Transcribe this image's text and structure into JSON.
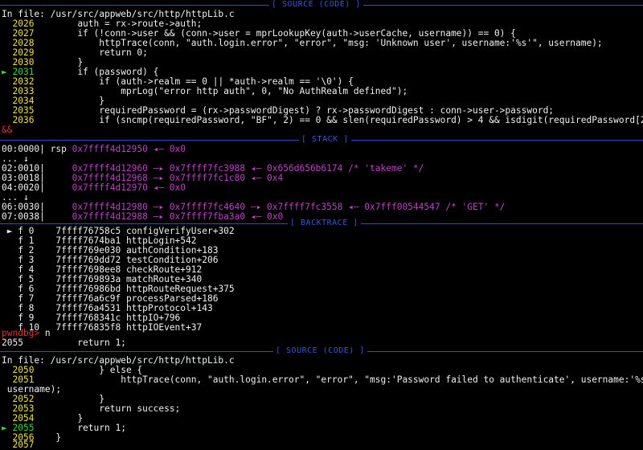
{
  "pane_titles": {
    "source_top": "[ SOURCE (CODE) ]",
    "stack": "[ STACK ]",
    "backtrace": "[ BACKTRACE ]",
    "source_bottom": "[ SOURCE (CODE) ]"
  },
  "source_top": {
    "file_label": "In file: /usr/src/appweb/src/http/httpLib.c",
    "lines": [
      {
        "no": "2026",
        "code": "        auth = rx->route->auth;",
        "current": false
      },
      {
        "no": "2027",
        "code": "        if (!conn->user && (conn->user = mprLookupKey(auth->userCache, username)) == 0) {",
        "current": false
      },
      {
        "no": "2028",
        "code": "            httpTrace(conn, \"auth.login.error\", \"error\", \"msg: 'Unknown user', username:'%s'\", username);",
        "current": false
      },
      {
        "no": "2029",
        "code": "            return 0;",
        "current": false
      },
      {
        "no": "2030",
        "code": "        }",
        "current": false
      },
      {
        "no": "2031",
        "code": "        if (password) {",
        "current": true
      },
      {
        "no": "2032",
        "code": "            if (auth->realm == 0 || *auth->realm == '\\0') {",
        "current": false
      },
      {
        "no": "2033",
        "code": "                mprLog(\"error http auth\", 0, \"No AuthRealm defined\");",
        "current": false
      },
      {
        "no": "2034",
        "code": "            }",
        "current": false
      },
      {
        "no": "2035",
        "code": "            requiredPassword = (rx->passwordDigest) ? rx->passwordDigest : conn->user->password;",
        "current": false
      },
      {
        "no": "2036",
        "code": "            if (sncmp(requiredPassword, \"BF\", 2) == 0 && slen(requiredPassword) > 4 && isdigit(requiredPassword[2])",
        "current": false
      }
    ],
    "wrap": "&&"
  },
  "stack": [
    {
      "off": "00:0000|",
      "reg": " rsp ",
      "chain": "0x7ffff4d12950 ◂— 0x0"
    },
    {
      "off": "... ↓",
      "reg": "",
      "chain": ""
    },
    {
      "off": "02:0010|",
      "reg": "     ",
      "chain": "0x7ffff4d12960 —▸ 0x7ffff7fc3988 ◂— 0x656d656b6174 /* 'takeme' */"
    },
    {
      "off": "03:0018|",
      "reg": "     ",
      "chain": "0x7ffff4d12968 —▸ 0x7ffff7fc1c80 ◂— 0x4"
    },
    {
      "off": "04:0020|",
      "reg": "     ",
      "chain": "0x7ffff4d12970 ◂— 0x0"
    },
    {
      "off": "... ↓",
      "reg": "",
      "chain": ""
    },
    {
      "off": "06:0030|",
      "reg": "     ",
      "chain": "0x7ffff4d12980 —▸ 0x7ffff7fc4640 —▸ 0x7ffff7fc3558 ◂— 0x7fff00544547 /* 'GET' */"
    },
    {
      "off": "07:0038|",
      "reg": "     ",
      "chain": "0x7ffff4d12988 —▸ 0x7ffff7fba3a0 ◂— 0x0"
    }
  ],
  "backtrace": [
    {
      "frame": " ► f 0 ",
      "addr": "   7ffff76758c5",
      "sym": " configVerifyUser+302"
    },
    {
      "frame": "   f 1 ",
      "addr": "   7ffff7674ba1",
      "sym": " httpLogin+542"
    },
    {
      "frame": "   f 2 ",
      "addr": "   7ffff769e030",
      "sym": " authCondition+183"
    },
    {
      "frame": "   f 3 ",
      "addr": "   7ffff769dd72",
      "sym": " testCondition+206"
    },
    {
      "frame": "   f 4 ",
      "addr": "   7ffff7698ee8",
      "sym": " checkRoute+912"
    },
    {
      "frame": "   f 5 ",
      "addr": "   7ffff769893a",
      "sym": " matchRoute+340"
    },
    {
      "frame": "   f 6 ",
      "addr": "   7ffff76986bd",
      "sym": " httpRouteRequest+375"
    },
    {
      "frame": "   f 7 ",
      "addr": "   7ffff76a6c9f",
      "sym": " processParsed+186"
    },
    {
      "frame": "   f 8 ",
      "addr": "   7ffff76a4531",
      "sym": " httpProtocol+143"
    },
    {
      "frame": "   f 9 ",
      "addr": "   7ffff768341c",
      "sym": " httpIO+796"
    },
    {
      "frame": "   f 10",
      "addr": "   7ffff76835f8",
      "sym": " httpIOEvent+37"
    }
  ],
  "prompt": {
    "label": "pwndbg> ",
    "command": "n"
  },
  "step_output": "2055          return 1;",
  "source_bottom": {
    "file_label": "In file: /usr/src/appweb/src/http/httpLib.c",
    "lines": [
      {
        "no": "2050",
        "code": "            } else {",
        "current": false
      },
      {
        "no": "2051",
        "code": "                httpTrace(conn, \"auth.login.error\", \"error\", \"msg:'Password failed to authenticate', username:'%s'\",",
        "current": false
      },
      {
        "no": "",
        "code": " username);",
        "current": false
      },
      {
        "no": "2052",
        "code": "            }",
        "current": false
      },
      {
        "no": "2053",
        "code": "            return success;",
        "current": false
      },
      {
        "no": "2054",
        "code": "        }",
        "current": false
      },
      {
        "no": "2055",
        "code": "        return 1;",
        "current": true
      },
      {
        "no": "2056",
        "code": "    }",
        "current": false
      },
      {
        "no": "2057",
        "code": "",
        "current": false
      }
    ]
  }
}
